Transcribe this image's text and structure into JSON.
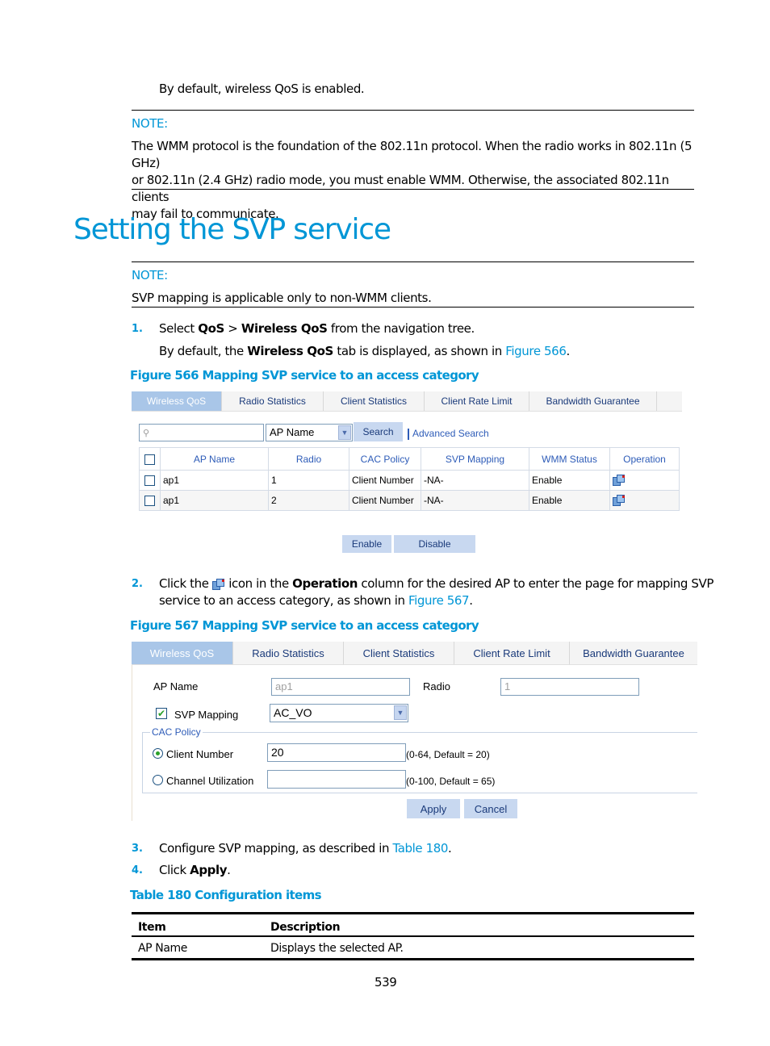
{
  "intro_text": "By default, wireless QoS is enabled.",
  "note1": {
    "label": "NOTE:",
    "lines": [
      "The WMM protocol is the foundation of the 802.11n protocol. When the radio works in 802.11n (5 GHz)",
      "or 802.11n (2.4 GHz) radio mode, you must enable WMM. Otherwise, the associated 802.11n clients",
      "may fail to communicate."
    ]
  },
  "heading": "Setting the SVP service",
  "note2": {
    "label": "NOTE:",
    "text": "SVP mapping is applicable only to non-WMM clients."
  },
  "steps": [
    {
      "num": "1.",
      "parts": [
        "Select ",
        "QoS",
        " > ",
        "Wireless QoS",
        " from the navigation tree."
      ],
      "sub": [
        "By default, the ",
        "Wireless QoS",
        " tab is displayed, as shown in ",
        "Figure 566",
        "."
      ]
    },
    {
      "num": "2.",
      "parts": [
        "Click the ",
        " icon in the ",
        "Operation",
        " column for the desired AP to enter the page for mapping SVP"
      ],
      "line2": [
        "service to an access category, as shown in ",
        "Figure 567",
        "."
      ]
    },
    {
      "num": "3.",
      "parts": [
        "Configure SVP mapping, as described in ",
        "Table 180",
        "."
      ]
    },
    {
      "num": "4.",
      "parts": [
        "Click ",
        "Apply",
        "."
      ]
    }
  ],
  "figure566": {
    "caption": "Figure 566 Mapping SVP service to an access category",
    "tabs": [
      "Wireless QoS",
      "Radio Statistics",
      "Client Statistics",
      "Client Rate Limit",
      "Bandwidth Guarantee"
    ],
    "search": {
      "value": "",
      "field_select": "AP Name",
      "search_label": "Search",
      "advanced_label": "Advanced Search"
    },
    "table": {
      "headers": [
        "AP Name",
        "Radio",
        "CAC Policy",
        "SVP Mapping",
        "WMM Status",
        "Operation"
      ],
      "rows": [
        {
          "ap_name": "ap1",
          "radio": "1",
          "cac_policy": "Client Number",
          "svp_mapping": "-NA-",
          "wmm_status": "Enable",
          "operation": "edit-icon"
        },
        {
          "ap_name": "ap1",
          "radio": "2",
          "cac_policy": "Client Number",
          "svp_mapping": "-NA-",
          "wmm_status": "Enable",
          "operation": "edit-icon"
        }
      ]
    },
    "buttons": {
      "enable": "Enable",
      "disable": "Disable"
    }
  },
  "figure567": {
    "caption": "Figure 567 Mapping SVP service to an access category",
    "tabs": [
      "Wireless QoS",
      "Radio Statistics",
      "Client Statistics",
      "Client Rate Limit",
      "Bandwidth Guarantee"
    ],
    "ap_name_label": "AP Name",
    "ap_name_value": "ap1",
    "radio_label": "Radio",
    "radio_value": "1",
    "svp_mapping_label": "SVP Mapping",
    "svp_mapping_checked": true,
    "svp_mapping_value": "AC_VO",
    "cac_policy_legend": "CAC Policy",
    "client_number_label": "Client Number",
    "client_number_value": "20",
    "client_number_hint": "(0-64, Default = 20)",
    "client_number_selected": true,
    "channel_util_label": "Channel Utilization",
    "channel_util_value": "",
    "channel_util_hint": "(0-100, Default = 65)",
    "apply_label": "Apply",
    "cancel_label": "Cancel"
  },
  "table180": {
    "caption": "Table 180 Configuration items",
    "headers": [
      "Item",
      "Description"
    ],
    "rows": [
      [
        "AP Name",
        "Displays the selected AP."
      ]
    ]
  },
  "page_number": "539",
  "colors": {
    "accent": "#0096d6",
    "tab_active": "#a9c6e8",
    "button": "#c8d8f0"
  }
}
